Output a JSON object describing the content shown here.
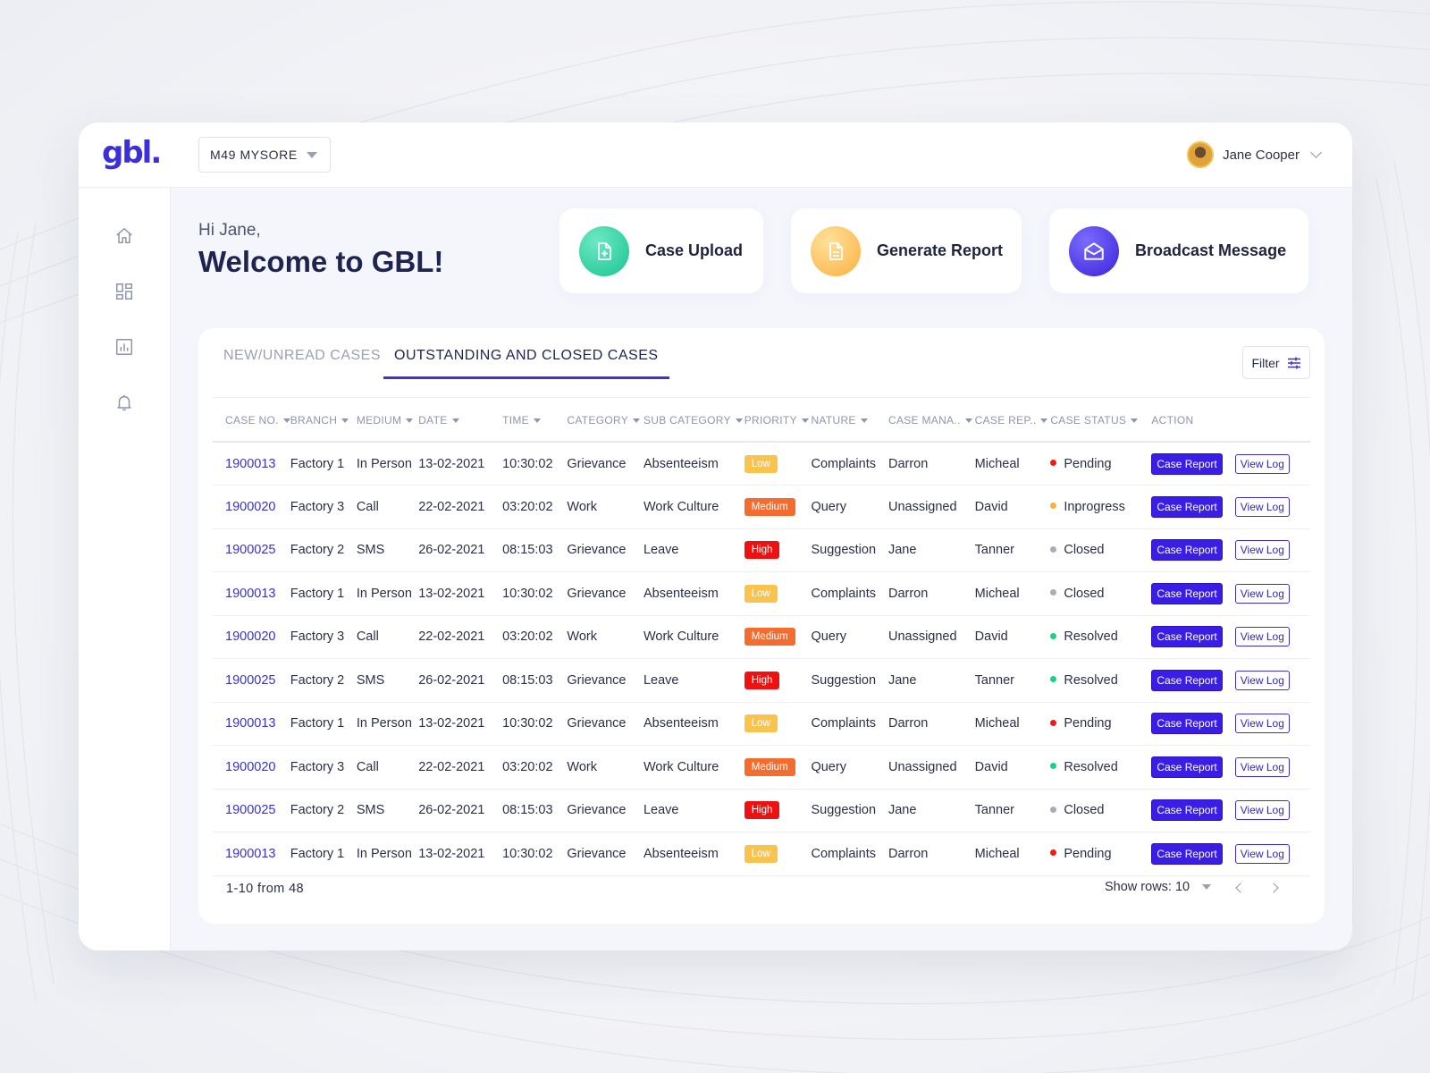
{
  "header": {
    "logo": "gbl.",
    "branch": "M49 MYSORE",
    "user_name": "Jane Cooper"
  },
  "sidebar": {
    "items": [
      {
        "icon": "home-icon"
      },
      {
        "icon": "dashboard-icon"
      },
      {
        "icon": "chart-icon"
      },
      {
        "icon": "bell-icon"
      }
    ]
  },
  "welcome": {
    "greeting": "Hi Jane,",
    "title": "Welcome to GBL!"
  },
  "actions": [
    {
      "label": "Case Upload",
      "icon": "file-plus-icon",
      "color": "#2ed3a3"
    },
    {
      "label": "Generate Report",
      "icon": "document-icon",
      "color": "#fbbf4f"
    },
    {
      "label": "Broadcast Message",
      "icon": "envelope-icon",
      "color": "#4a3be6"
    }
  ],
  "tabs": {
    "inactive": "NEW/UNREAD CASES",
    "active": "OUTSTANDING AND CLOSED CASES"
  },
  "filter_label": "Filter",
  "table": {
    "columns": [
      "CASE NO.",
      "BRANCH",
      "MEDIUM",
      "DATE",
      "TIME",
      "CATEGORY",
      "SUB CATEGORY",
      "PRIORITY",
      "NATURE",
      "CASE MANA..",
      "CASE REP..",
      "CASE STATUS",
      "ACTION"
    ],
    "action_report": "Case Report",
    "action_log": "View Log",
    "rows": [
      {
        "case": "1900013",
        "branch": "Factory 1",
        "medium": "In Person",
        "date": "13-02-2021",
        "time": "10:30:02",
        "category": "Grievance",
        "sub": "Absenteeism",
        "priority": "Low",
        "nature": "Complaints",
        "manager": "Darron",
        "rep": "Micheal",
        "status": "Pending"
      },
      {
        "case": "1900020",
        "branch": "Factory 3",
        "medium": "Call",
        "date": "22-02-2021",
        "time": "03:20:02",
        "category": "Work",
        "sub": "Work Culture",
        "priority": "Medium",
        "nature": "Query",
        "manager": "Unassigned",
        "rep": "David",
        "status": "Inprogress"
      },
      {
        "case": "1900025",
        "branch": "Factory 2",
        "medium": "SMS",
        "date": "26-02-2021",
        "time": "08:15:03",
        "category": "Grievance",
        "sub": "Leave",
        "priority": "High",
        "nature": "Suggestion",
        "manager": "Jane",
        "rep": "Tanner",
        "status": "Closed"
      },
      {
        "case": "1900013",
        "branch": "Factory 1",
        "medium": "In Person",
        "date": "13-02-2021",
        "time": "10:30:02",
        "category": "Grievance",
        "sub": "Absenteeism",
        "priority": "Low",
        "nature": "Complaints",
        "manager": "Darron",
        "rep": "Micheal",
        "status": "Closed"
      },
      {
        "case": "1900020",
        "branch": "Factory 3",
        "medium": "Call",
        "date": "22-02-2021",
        "time": "03:20:02",
        "category": "Work",
        "sub": "Work Culture",
        "priority": "Medium",
        "nature": "Query",
        "manager": "Unassigned",
        "rep": "David",
        "status": "Resolved"
      },
      {
        "case": "1900025",
        "branch": "Factory 2",
        "medium": "SMS",
        "date": "26-02-2021",
        "time": "08:15:03",
        "category": "Grievance",
        "sub": "Leave",
        "priority": "High",
        "nature": "Suggestion",
        "manager": "Jane",
        "rep": "Tanner",
        "status": "Resolved"
      },
      {
        "case": "1900013",
        "branch": "Factory 1",
        "medium": "In Person",
        "date": "13-02-2021",
        "time": "10:30:02",
        "category": "Grievance",
        "sub": "Absenteeism",
        "priority": "Low",
        "nature": "Complaints",
        "manager": "Darron",
        "rep": "Micheal",
        "status": "Pending"
      },
      {
        "case": "1900020",
        "branch": "Factory 3",
        "medium": "Call",
        "date": "22-02-2021",
        "time": "03:20:02",
        "category": "Work",
        "sub": "Work Culture",
        "priority": "Medium",
        "nature": "Query",
        "manager": "Unassigned",
        "rep": "David",
        "status": "Resolved"
      },
      {
        "case": "1900025",
        "branch": "Factory 2",
        "medium": "SMS",
        "date": "26-02-2021",
        "time": "08:15:03",
        "category": "Grievance",
        "sub": "Leave",
        "priority": "High",
        "nature": "Suggestion",
        "manager": "Jane",
        "rep": "Tanner",
        "status": "Closed"
      },
      {
        "case": "1900013",
        "branch": "Factory 1",
        "medium": "In Person",
        "date": "13-02-2021",
        "time": "10:30:02",
        "category": "Grievance",
        "sub": "Absenteeism",
        "priority": "Low",
        "nature": "Complaints",
        "manager": "Darron",
        "rep": "Micheal",
        "status": "Pending"
      }
    ]
  },
  "status_colors": {
    "Pending": "#ee1b1b",
    "Inprogress": "#f6b33c",
    "Closed": "#a7abbd",
    "Resolved": "#1ccf86"
  },
  "footer": {
    "count": "1-10 from 48",
    "rows_label": "Show rows: 10"
  }
}
